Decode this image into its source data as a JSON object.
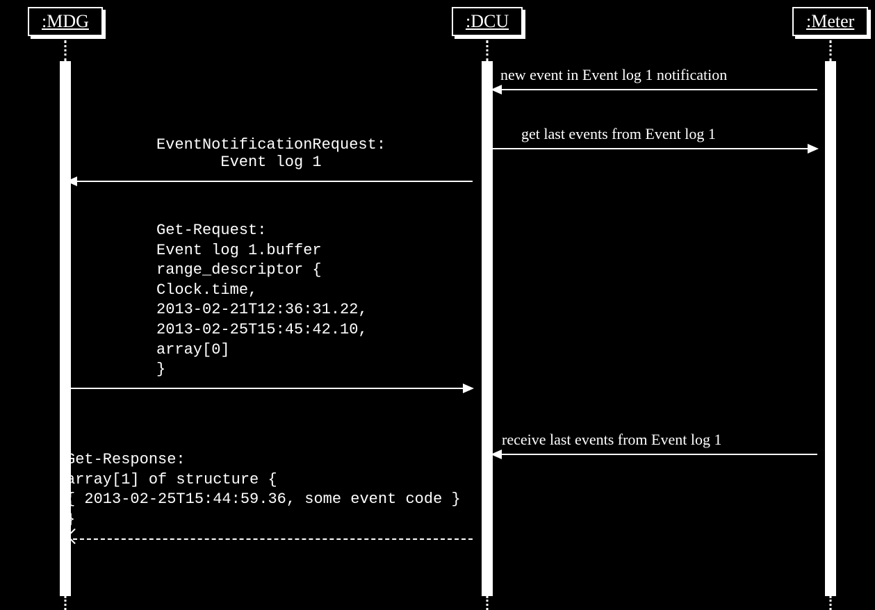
{
  "participants": {
    "mdg": ":MDG",
    "dcu": ":DCU",
    "meter": ":Meter"
  },
  "messages": {
    "m1": "new event in Event log 1 notification",
    "m2": "get last events from Event log 1",
    "m3_l1": "EventNotificationRequest:",
    "m3_l2": "Event log 1",
    "m4": "Get-Request:\nEvent log 1.buffer\nrange_descriptor {\nClock.time,\n2013-02-21T12:36:31.22,\n2013-02-25T15:45:42.10,\narray[0]\n}",
    "m5": "receive last events from Event log 1",
    "m6": "Get-Response:\narray[1] of structure {\n{ 2013-02-25T15:44:59.36, some event code }\n}"
  },
  "chart_data": {
    "type": "sequence_diagram",
    "participants": [
      "MDG",
      "DCU",
      "Meter"
    ],
    "messages": [
      {
        "from": "Meter",
        "to": "DCU",
        "label": "new event in Event log 1 notification",
        "style": "solid"
      },
      {
        "from": "DCU",
        "to": "Meter",
        "label": "get last events from Event log 1",
        "style": "solid"
      },
      {
        "from": "DCU",
        "to": "MDG",
        "label": "EventNotificationRequest: Event log 1",
        "style": "solid"
      },
      {
        "from": "MDG",
        "to": "DCU",
        "label": "Get-Request: Event log 1.buffer range_descriptor { Clock.time, 2013-02-21T12:36:31.22, 2013-02-25T15:45:42.10, array[0] }",
        "style": "solid"
      },
      {
        "from": "Meter",
        "to": "DCU",
        "label": "receive last events from Event log 1",
        "style": "solid"
      },
      {
        "from": "DCU",
        "to": "MDG",
        "label": "Get-Response: array[1] of structure { { 2013-02-25T15:44:59.36, some event code } }",
        "style": "dashed"
      }
    ]
  }
}
